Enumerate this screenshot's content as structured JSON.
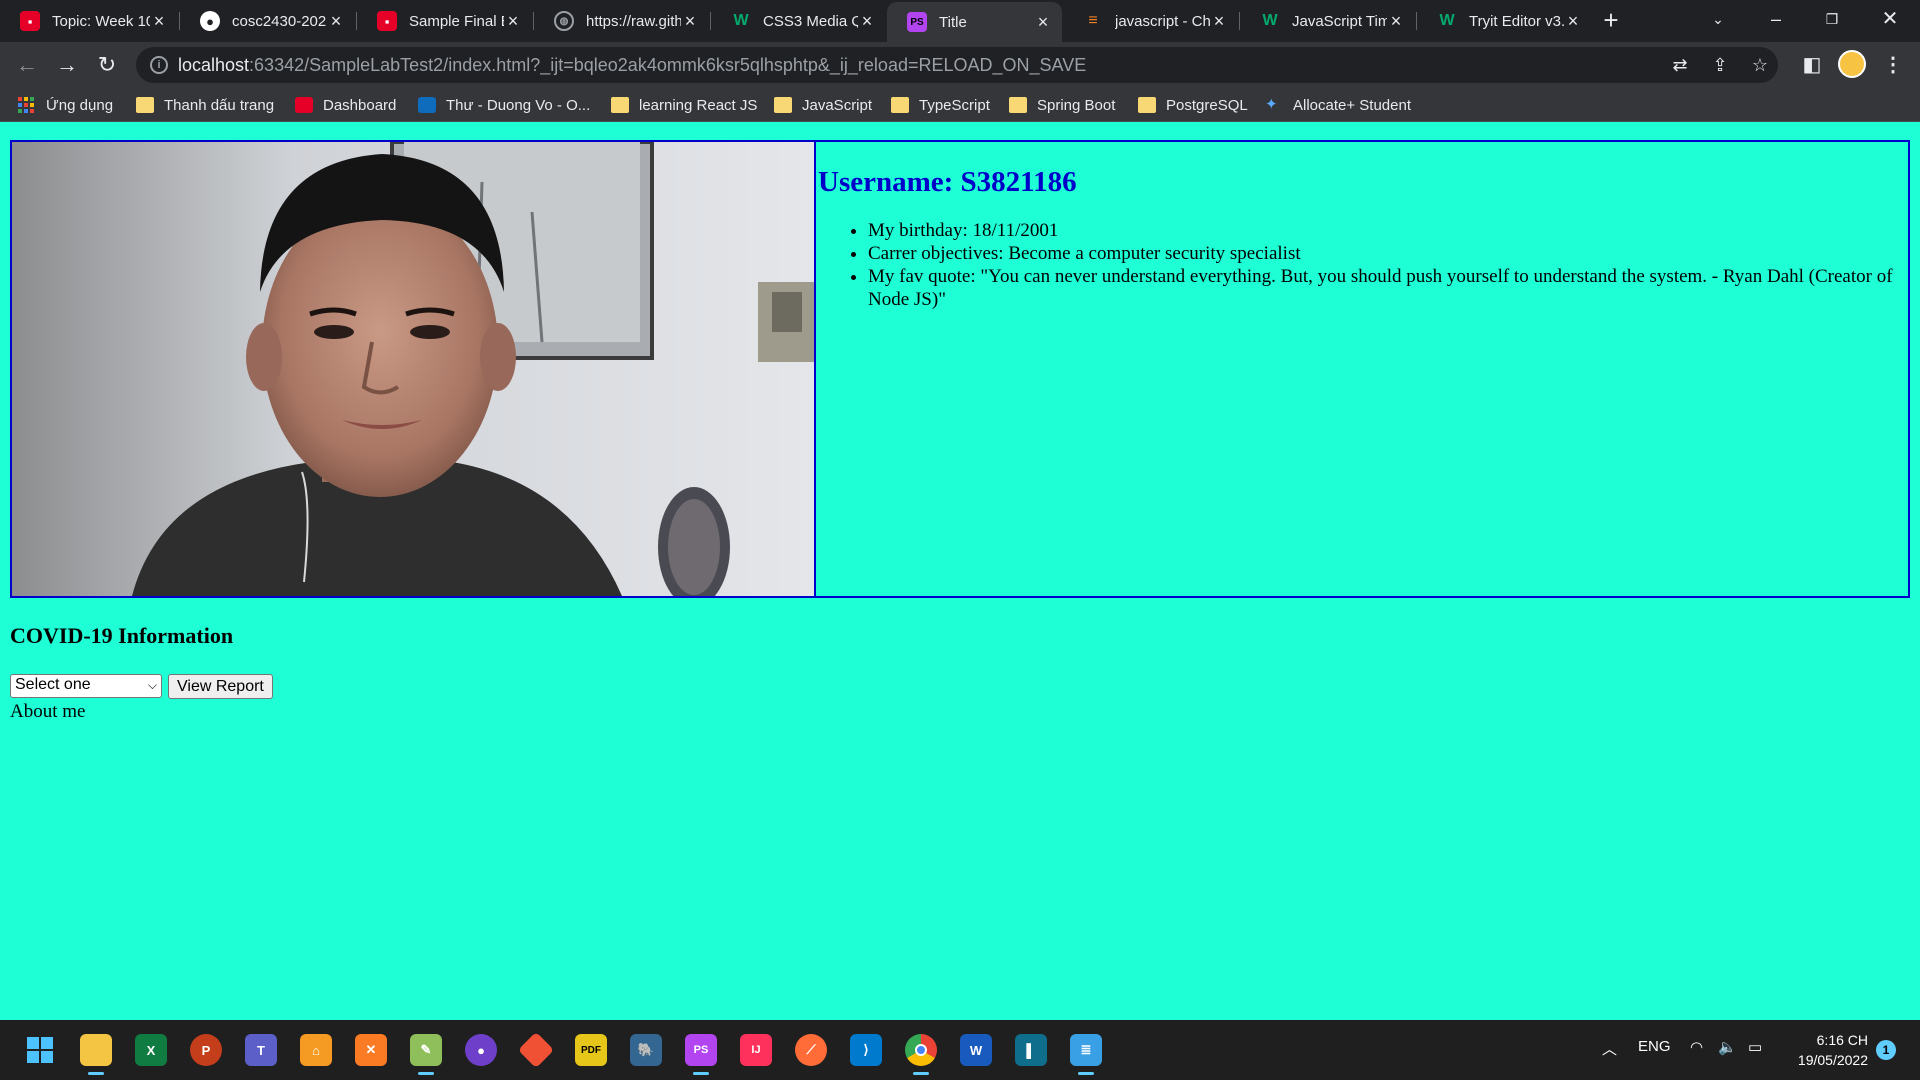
{
  "browser": {
    "tabs": [
      {
        "label": "Topic: Week 10",
        "icon": "rmit-icon",
        "color": "#e60028"
      },
      {
        "label": "cosc2430-2022",
        "icon": "github-icon",
        "color": "#ffffff"
      },
      {
        "label": "Sample Final E",
        "icon": "rmit-icon",
        "color": "#e60028"
      },
      {
        "label": "https://raw.gith",
        "icon": "globe-icon",
        "color": "#9aa0a6"
      },
      {
        "label": "CSS3 Media Q",
        "icon": "w3schools-icon",
        "color": "#04aa6d"
      },
      {
        "label": "Title",
        "icon": "phpstorm-icon",
        "color": "#b345f1"
      },
      {
        "label": "javascript - Ch",
        "icon": "stackoverflow-icon",
        "color": "#f48024"
      },
      {
        "label": "JavaScript Tim",
        "icon": "w3schools-icon",
        "color": "#04aa6d"
      },
      {
        "label": "Tryit Editor v3.",
        "icon": "w3schools-icon",
        "color": "#04aa6d"
      }
    ],
    "active_tab_index": 5,
    "url_host": "localhost",
    "url_rest": ":63342/SampleLabTest2/index.html?_ijt=bqleo2ak4ommk6ksr5qlhsphtp&_ij_reload=RELOAD_ON_SAVE",
    "bookmarks": [
      {
        "label": "Ứng dụng",
        "icon": "apps-grid-icon"
      },
      {
        "label": "Thanh dấu trang",
        "icon": "folder-icon"
      },
      {
        "label": "Dashboard",
        "icon": "rmit-icon"
      },
      {
        "label": "Thư - Duong Vo - O...",
        "icon": "outlook-icon"
      },
      {
        "label": "learning React JS",
        "icon": "folder-icon"
      },
      {
        "label": "JavaScript",
        "icon": "folder-icon"
      },
      {
        "label": "TypeScript",
        "icon": "folder-icon"
      },
      {
        "label": "Spring Boot",
        "icon": "folder-icon"
      },
      {
        "label": "PostgreSQL",
        "icon": "folder-icon"
      },
      {
        "label": "Allocate+ Student",
        "icon": "allocate-icon"
      }
    ]
  },
  "page": {
    "username": "Username: S3821186",
    "details": [
      "My birthday: 18/11/2001",
      "Carrer objectives: Become a computer security specialist",
      "My fav quote: \"You can never understand everything. But, you should push yourself to understand the system. - Ryan Dahl (Creator of Node JS)\""
    ],
    "covid_title": "COVID-19 Information",
    "select_value": "Select one",
    "view_report_label": "View Report",
    "about_label": "About me",
    "background_color": "#1effd6",
    "border_color": "#0000c8"
  },
  "taskbar": {
    "apps": [
      "windows-start-icon",
      "file-explorer-icon",
      "excel-icon",
      "powerpoint-icon",
      "teams-icon",
      "mindmap-icon",
      "xampp-icon",
      "notepadpp-icon",
      "github-desktop-icon",
      "git-icon",
      "pdf-icon",
      "postgresql-icon",
      "phpstorm-icon",
      "intellij-icon",
      "postman-icon",
      "vscode-icon",
      "chrome-icon",
      "word-icon",
      "sidebar-app-icon",
      "notepad-icon"
    ],
    "language": "ENG",
    "time": "6:16 CH",
    "date": "19/05/2022",
    "notification_count": "1"
  }
}
